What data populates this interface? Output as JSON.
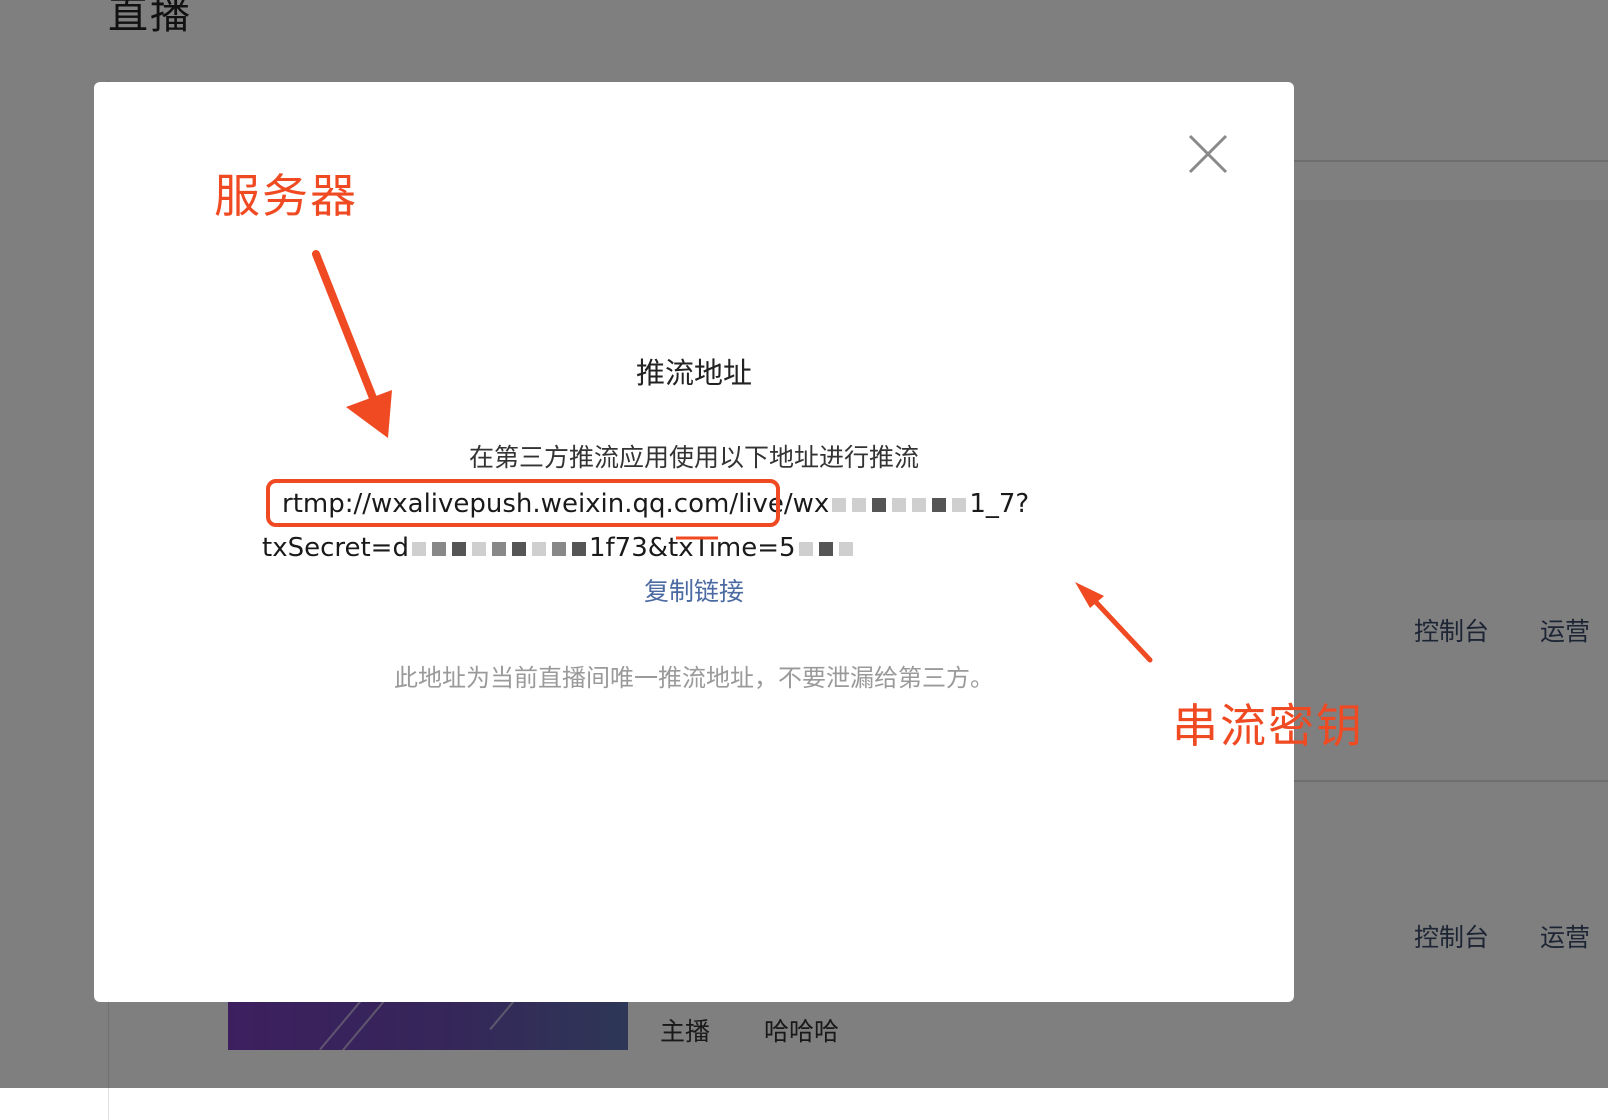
{
  "background": {
    "page_title": "直播",
    "rows": [
      {
        "actions": [
          "控制台",
          "运营"
        ]
      },
      {
        "actions": [
          "控制台",
          "运营"
        ]
      }
    ],
    "row_meta": {
      "role_label": "主播",
      "role_value": "哈哈哈"
    }
  },
  "modal": {
    "title": "推流地址",
    "instruction": "在第三方推流应用使用以下地址进行推流",
    "url": {
      "server": "rtmp://wxalivepush.weixin.qq.com/live/",
      "line1_visible_tail": "wx",
      "line1_end": "1_7?",
      "line2_prefix": "txSecret=d",
      "line2_mid": "1f73&txTime=5"
    },
    "copy_link": "复制链接",
    "warning": "此地址为当前直播间唯一推流地址，不要泄漏给第三方。"
  },
  "annotations": {
    "server_label": "服务器",
    "stream_key_label": "串流密钥",
    "color": "#f04a23"
  },
  "icons": {
    "close": "close-icon"
  }
}
